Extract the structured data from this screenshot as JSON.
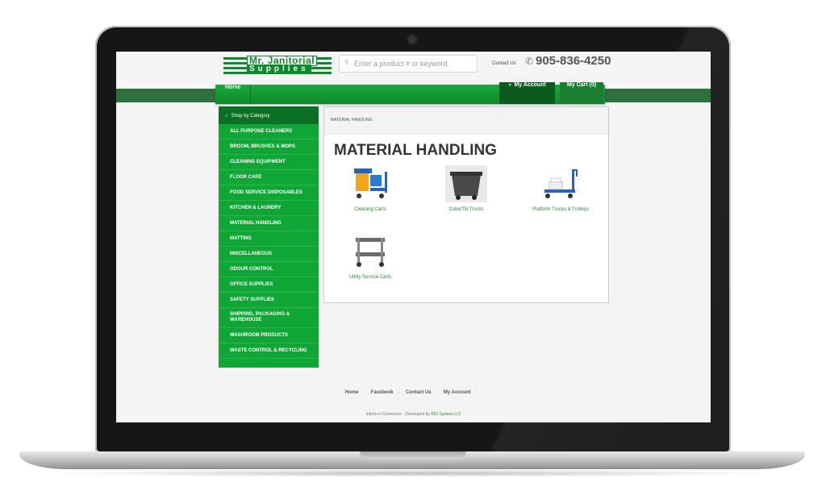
{
  "header": {
    "logo_line1": "Mr. Janitorial",
    "logo_line2": "Supplies",
    "search_placeholder": "Enter a product # or keyword",
    "contact_label": "Contact Us",
    "phone": "905-836-4250"
  },
  "nav": {
    "home": "Home",
    "my_account": "My Account",
    "my_cart": "My Cart (0)"
  },
  "sidebar": {
    "heading": "Shop by Category",
    "items": [
      "ALL PURPOSE CLEANERS",
      "BROOM, BRUSHES & MOPS",
      "CLEANING EQUIPMENT",
      "FLOOR CARE",
      "FOOD SERVICE DISPOSABLES",
      "KITCHEN & LAUNDRY",
      "MATERIAL HANDLING",
      "MATTING",
      "MISCELLANEOUS",
      "ODOUR CONTROL",
      "OFFICE SUPPLIES",
      "SAFETY SUPPLIES",
      "SHIPPING, PACKAGING & WAREHOUSE",
      "WASHROOM PRODUCTS",
      "WASTE CONTROL & RECYCLING"
    ]
  },
  "main": {
    "breadcrumb": "MATERIAL HANDLING",
    "title": "MATERIAL HANDLING",
    "products": [
      {
        "label": "Cleaning Carts",
        "icon": "cleaning-cart-image"
      },
      {
        "label": "Cube/Tilt Trucks",
        "icon": "tilt-truck-image"
      },
      {
        "label": "Platform Trucks & Trolleys",
        "icon": "platform-truck-image"
      },
      {
        "label": "Utility Service Carts",
        "icon": "utility-cart-image"
      }
    ]
  },
  "footer": {
    "links": [
      "Home",
      "Facebook",
      "Contact Us",
      "My Account"
    ],
    "credit_prefix": "Inform e-Commerce - Developed by ",
    "credit_link": "DDI System LLC"
  },
  "colors": {
    "brand_green": "#0fa635",
    "dark_green": "#0b6f25",
    "link_green": "#2a8a3a"
  }
}
